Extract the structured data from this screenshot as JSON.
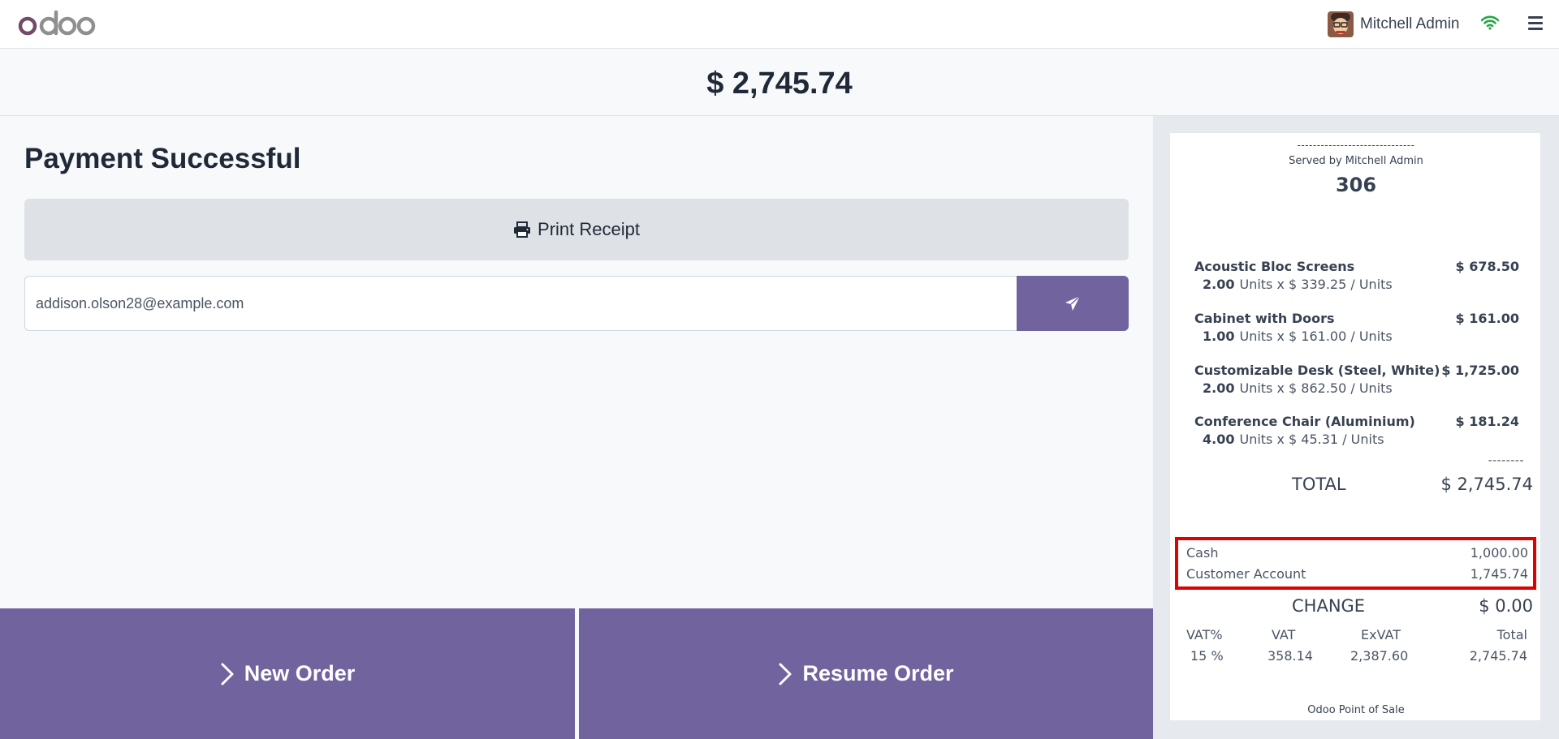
{
  "topbar": {
    "logo_text": "odoo",
    "user_name": "Mitchell Admin",
    "icons": [
      "wifi-icon",
      "hamburger-menu-icon"
    ]
  },
  "order": {
    "amount": "$ 2,745.74"
  },
  "payment": {
    "title": "Payment Successful",
    "print_label": "Print Receipt",
    "email_value": "addison.olson28@example.com",
    "new_order_label": "New Order",
    "resume_order_label": "Resume Order"
  },
  "receipt": {
    "header_dashes": "------------------------------",
    "served_by": "Served by Mitchell Admin",
    "order_number": "306",
    "lines": [
      {
        "name": "Acoustic Bloc Screens",
        "price": "$ 678.50",
        "qty": "2.00",
        "detail": "Units x $ 339.25 / Units"
      },
      {
        "name": "Cabinet with Doors",
        "price": "$ 161.00",
        "qty": "1.00",
        "detail": "Units x $ 161.00 / Units"
      },
      {
        "name": "Customizable Desk (Steel, White)",
        "price": "$ 1,725.00",
        "qty": "2.00",
        "detail": "Units x $ 862.50 / Units"
      },
      {
        "name": "Conference Chair (Aluminium)",
        "price": "$ 181.24",
        "qty": "4.00",
        "detail": "Units x $ 45.31 / Units"
      }
    ],
    "dashes": "--------",
    "total_label": "TOTAL",
    "total_value": "$ 2,745.74",
    "payments": [
      {
        "method": "Cash",
        "amount": "1,000.00"
      },
      {
        "method": "Customer Account",
        "amount": "1,745.74"
      }
    ],
    "change_label": "CHANGE",
    "change_value": "$ 0.00",
    "tax_headers": [
      "VAT%",
      "VAT",
      "ExVAT",
      "Total"
    ],
    "tax_values": [
      "15 %",
      "358.14",
      "2,387.60",
      "2,745.74"
    ],
    "footer": "Odoo Point of Sale"
  },
  "colors": {
    "accent": "#71639e",
    "highlight_border": "#e00000",
    "wifi": "#28a745"
  }
}
